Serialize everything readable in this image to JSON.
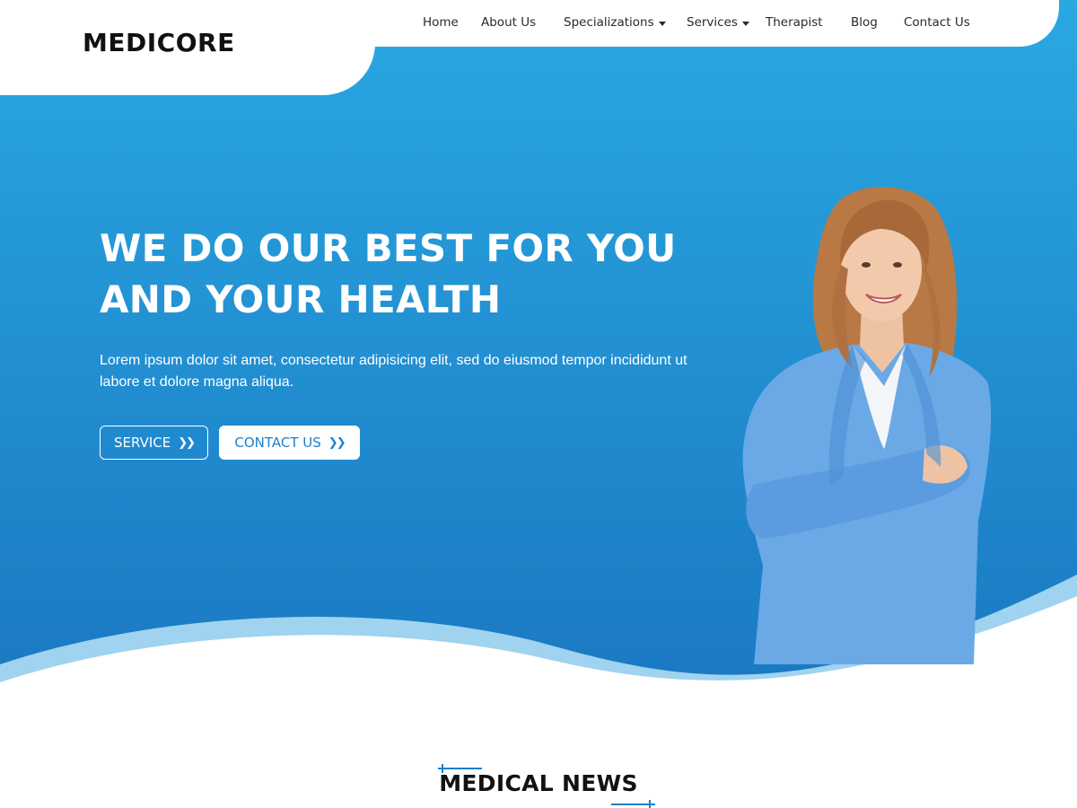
{
  "brand": {
    "logo": "MEDICORE"
  },
  "nav": {
    "items": [
      {
        "label": "Home",
        "dropdown": false
      },
      {
        "label": "About Us",
        "dropdown": false
      },
      {
        "label": "Specializations",
        "dropdown": true
      },
      {
        "label": "Services",
        "dropdown": true
      },
      {
        "label": "Therapist",
        "dropdown": false
      },
      {
        "label": "Blog",
        "dropdown": false
      },
      {
        "label": "Contact Us",
        "dropdown": false
      }
    ]
  },
  "hero": {
    "title_line1": "WE DO OUR BEST FOR YOU",
    "title_line2": "AND YOUR HEALTH",
    "description": "Lorem ipsum dolor sit amet, consectetur adipisicing elit, sed do eiusmod tempor incididunt ut labore et dolore magna aliqua.",
    "buttons": {
      "service_label": "SERVICE",
      "contact_label": "CONTACT US",
      "icon": "double-chevron-right-icon"
    },
    "image": "smiling-doctor-woman-in-blue-blazer"
  },
  "section": {
    "news_title": "MEDICAL NEWS"
  },
  "colors": {
    "hero_gradient_top": "#2aa8e2",
    "hero_gradient_bottom": "#1a78c2",
    "wave_light": "#9fd3ef",
    "accent": "#1f7fc8",
    "text_dark": "#1b1b1b"
  }
}
